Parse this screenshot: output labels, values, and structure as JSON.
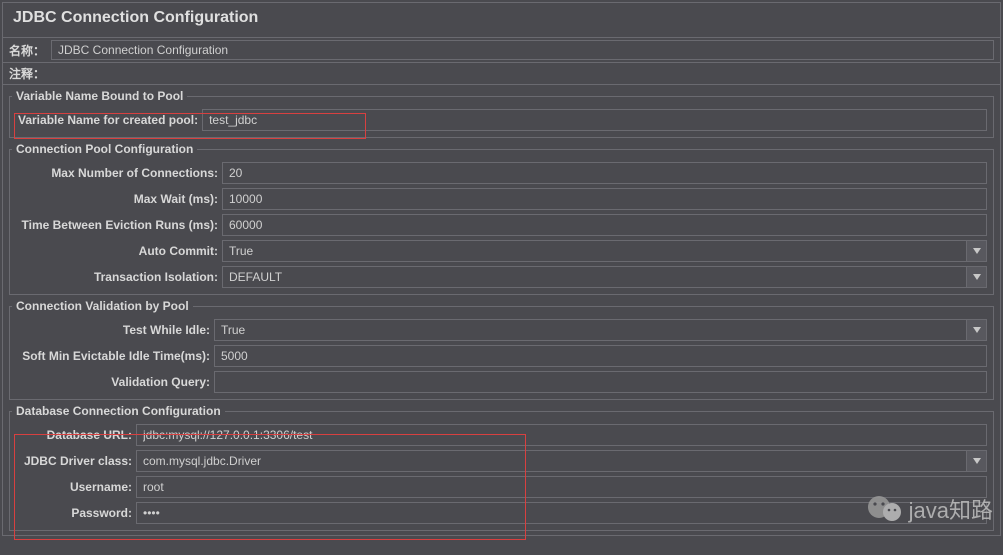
{
  "header": {
    "title": "JDBC Connection Configuration",
    "name_label": "名称：",
    "name_value": "JDBC Connection Configuration",
    "comment_label": "注释："
  },
  "variable_section": {
    "legend": "Variable Name Bound to Pool",
    "pool_name_label": "Variable Name for created pool:",
    "pool_name_value": "test_jdbc"
  },
  "pool_section": {
    "legend": "Connection Pool Configuration",
    "max_connections_label": "Max Number of Connections:",
    "max_connections_value": "20",
    "max_wait_label": "Max Wait (ms):",
    "max_wait_value": "10000",
    "eviction_runs_label": "Time Between Eviction Runs (ms):",
    "eviction_runs_value": "60000",
    "auto_commit_label": "Auto Commit:",
    "auto_commit_value": "True",
    "transaction_isolation_label": "Transaction Isolation:",
    "transaction_isolation_value": "DEFAULT"
  },
  "validation_section": {
    "legend": "Connection Validation by Pool",
    "test_while_idle_label": "Test While Idle:",
    "test_while_idle_value": "True",
    "soft_min_evictable_label": "Soft Min Evictable Idle Time(ms):",
    "soft_min_evictable_value": "5000",
    "validation_query_label": "Validation Query:",
    "validation_query_value": ""
  },
  "database_section": {
    "legend": "Database Connection Configuration",
    "db_url_label": "Database URL:",
    "db_url_value": "jdbc:mysql://127.0.0.1:3306/test",
    "driver_class_label": "JDBC Driver class:",
    "driver_class_value": "com.mysql.jdbc.Driver",
    "username_label": "Username:",
    "username_value": "root",
    "password_label": "Password:",
    "password_value": "••••"
  },
  "watermark": "java知路"
}
